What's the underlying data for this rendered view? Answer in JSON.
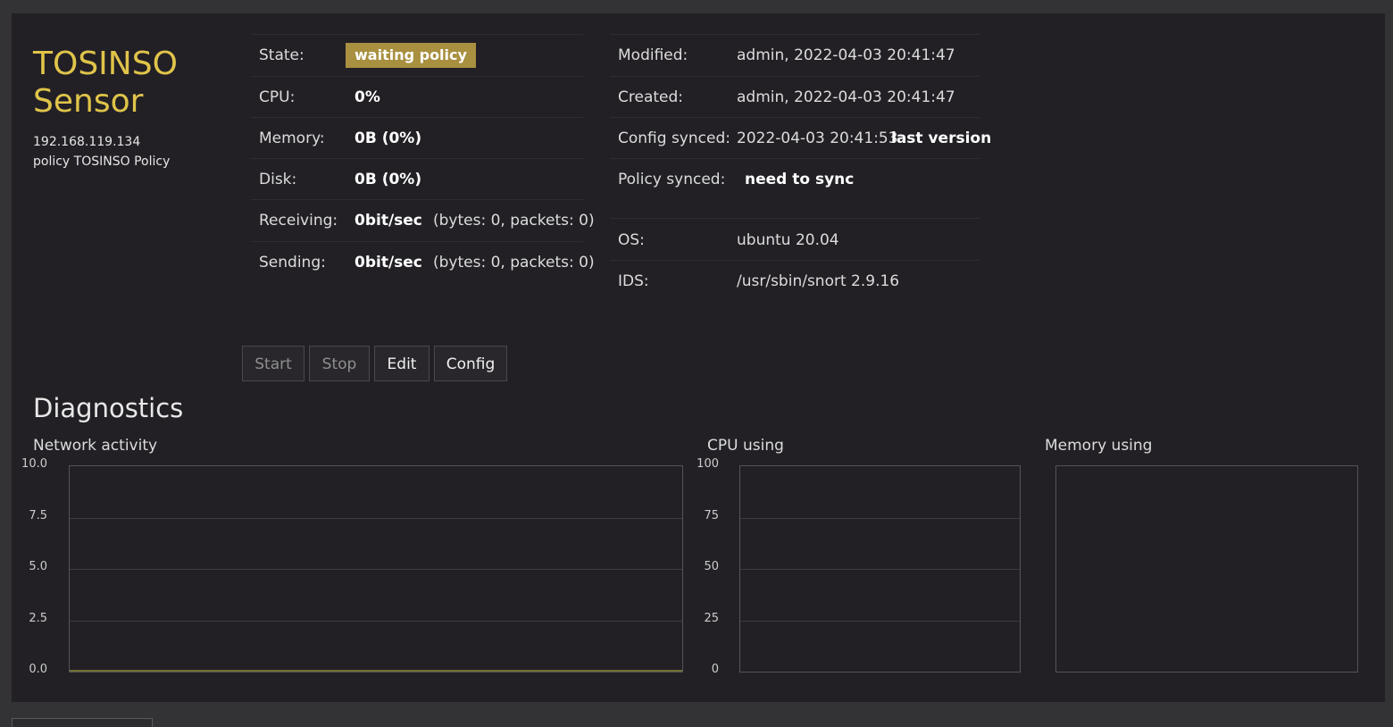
{
  "sensor": {
    "title_line1": "TOSINSO",
    "title_line2": "Sensor",
    "ip": "192.168.119.134",
    "policy": "policy TOSINSO Policy"
  },
  "status": {
    "state_label": "State:",
    "state_value": "waiting policy",
    "cpu_label": "CPU:",
    "cpu_value": "0%",
    "memory_label": "Memory:",
    "memory_value": "0B (0%)",
    "disk_label": "Disk:",
    "disk_value": "0B (0%)",
    "receiving_label": "Receiving:",
    "receiving_value": "0bit/sec",
    "receiving_detail": "(bytes: 0, packets: 0)",
    "sending_label": "Sending:",
    "sending_value": "0bit/sec",
    "sending_detail": "(bytes: 0, packets: 0)"
  },
  "info": {
    "modified_label": "Modified:",
    "modified_value": "admin, 2022-04-03 20:41:47",
    "created_label": "Created:",
    "created_value": "admin, 2022-04-03 20:41:47",
    "config_synced_label": "Config synced:",
    "config_synced_value": "2022-04-03 20:41:53",
    "config_synced_note": "last version",
    "policy_synced_label": "Policy synced:",
    "policy_synced_value": "need to sync",
    "os_label": "OS:",
    "os_value": "ubuntu 20.04",
    "ids_label": "IDS:",
    "ids_value": "/usr/sbin/snort 2.9.16"
  },
  "buttons": {
    "start": "Start",
    "stop": "Stop",
    "edit": "Edit",
    "config": "Config"
  },
  "diagnostics": {
    "heading": "Diagnostics"
  },
  "colors": {
    "accent": "#e0c44a",
    "badge": "#a89040",
    "panel": "#222025",
    "background": "#333235"
  },
  "chart_data": [
    {
      "type": "line",
      "title": "Network activity",
      "ylim": [
        0,
        10
      ],
      "yticks": [
        "10.0",
        "7.5",
        "5.0",
        "2.5",
        "0.0"
      ],
      "series": [
        {
          "values": [
            0,
            0
          ]
        }
      ],
      "grid": true
    },
    {
      "type": "line",
      "title": "CPU using",
      "ylim": [
        0,
        100
      ],
      "yticks": [
        "100",
        "75",
        "50",
        "25",
        "0"
      ],
      "series": [],
      "grid": true
    },
    {
      "type": "line",
      "title": "Memory using",
      "series": [],
      "grid": false
    }
  ]
}
